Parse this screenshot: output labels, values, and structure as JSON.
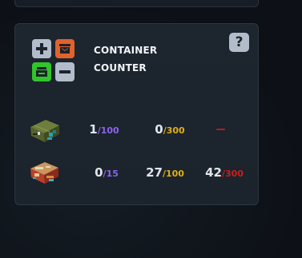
{
  "card": {
    "title_line1": "CONTAINER",
    "title_line2": "COUNTER",
    "help_label": "?",
    "colors": {
      "accent_orange": "#e0632c",
      "accent_green": "#31c52a",
      "tile_grey": "#b3bccb"
    },
    "controls": [
      {
        "icon": "plus-icon"
      },
      {
        "icon": "close-container-icon"
      },
      {
        "icon": "open-container-icon"
      },
      {
        "icon": "minus-icon"
      }
    ],
    "rows": [
      {
        "name": "green-crate",
        "stats": [
          {
            "value": "1",
            "sep": "/",
            "max": "100",
            "color": "purple"
          },
          {
            "value": "0",
            "sep": "/",
            "max": "300",
            "color": "yellow"
          },
          {
            "value": "",
            "sep": "",
            "max": "",
            "color": "red",
            "empty": true
          }
        ]
      },
      {
        "name": "orange-crate",
        "stats": [
          {
            "value": "0",
            "sep": "/",
            "max": "15",
            "color": "purple"
          },
          {
            "value": "27",
            "sep": "/",
            "max": "100",
            "color": "yellow"
          },
          {
            "value": "42",
            "sep": "/",
            "max": "300",
            "color": "red"
          }
        ]
      }
    ]
  }
}
